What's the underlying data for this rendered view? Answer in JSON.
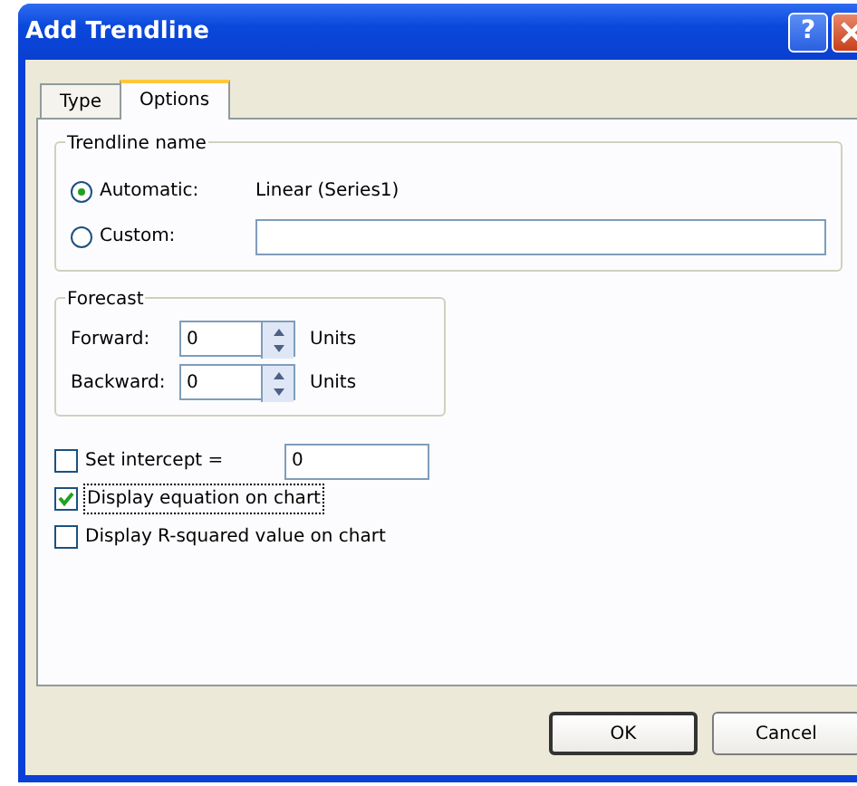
{
  "window": {
    "title": "Add Trendline",
    "help_button": "?"
  },
  "tabs": [
    {
      "label": "Type",
      "selected": false
    },
    {
      "label": "Options",
      "selected": true
    }
  ],
  "trendline_name": {
    "title": "Trendline name",
    "options": [
      {
        "kind": "text",
        "label": "Automatic:",
        "selected": true,
        "value": "Linear (Series1)"
      },
      {
        "kind": "field",
        "label": "Custom:",
        "selected": false
      }
    ]
  },
  "forecast": {
    "title": "Forecast",
    "rows": [
      {
        "label": "Forward:",
        "value": "0",
        "unit": "Units"
      },
      {
        "label": "Backward:",
        "value": "0",
        "unit": "Units"
      }
    ]
  },
  "options": [
    {
      "kind": "field",
      "label": "Set intercept =",
      "checked": false,
      "value": "0"
    },
    {
      "kind": "plain",
      "label": "Display equation on chart",
      "checked": true,
      "focused": true
    },
    {
      "kind": "plain",
      "label": "Display R-squared value on chart",
      "checked": false,
      "focused": false
    }
  ],
  "buttons": [
    {
      "label": "OK",
      "default": true
    },
    {
      "label": "Cancel",
      "default": false
    }
  ]
}
